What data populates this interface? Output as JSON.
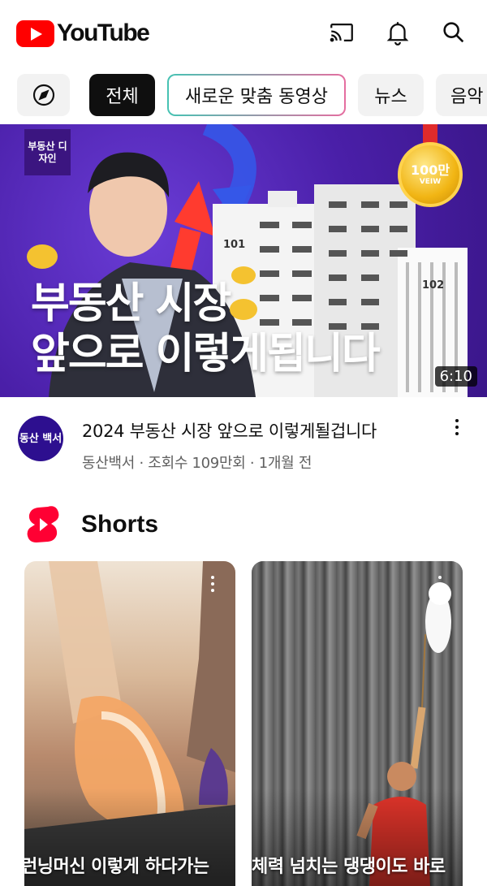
{
  "header": {
    "logo_text": "YouTube",
    "icons": [
      "cast-icon",
      "bell-icon",
      "search-icon"
    ]
  },
  "chips": {
    "explore_icon": "compass-icon",
    "items": [
      "전체",
      "새로운 맞춤 동영상",
      "뉴스",
      "음악"
    ],
    "selected": "전체"
  },
  "video": {
    "thumbnail_badge": "부동산 디자인",
    "thumbnail_medal_main": "100만",
    "thumbnail_medal_sub": "VEIW",
    "thumbnail_title_line1": "부동산 시장",
    "thumbnail_title_line2": "앞으로 이렇게됩니다",
    "thumbnail_building_1": "101",
    "thumbnail_building_2": "102",
    "duration": "6:10",
    "avatar_text": "동산 백서",
    "title": "2024 부동산 시장 앞으로 이렇게될겁니다",
    "meta": "동산백서 · 조회수 109만회 · 1개월 전"
  },
  "shorts": {
    "label": "Shorts",
    "items": [
      {
        "caption": "런닝머신 이렇게 하다가는"
      },
      {
        "caption": "체력 넘치는 댕댕이도 바로"
      }
    ]
  },
  "colors": {
    "brand_red": "#ff0000",
    "chip_active_bg": "#0f0f0f",
    "chip_bg": "#f2f2f2",
    "meta_text": "#606060",
    "thumbnail_purple": "#4a1fa8"
  }
}
